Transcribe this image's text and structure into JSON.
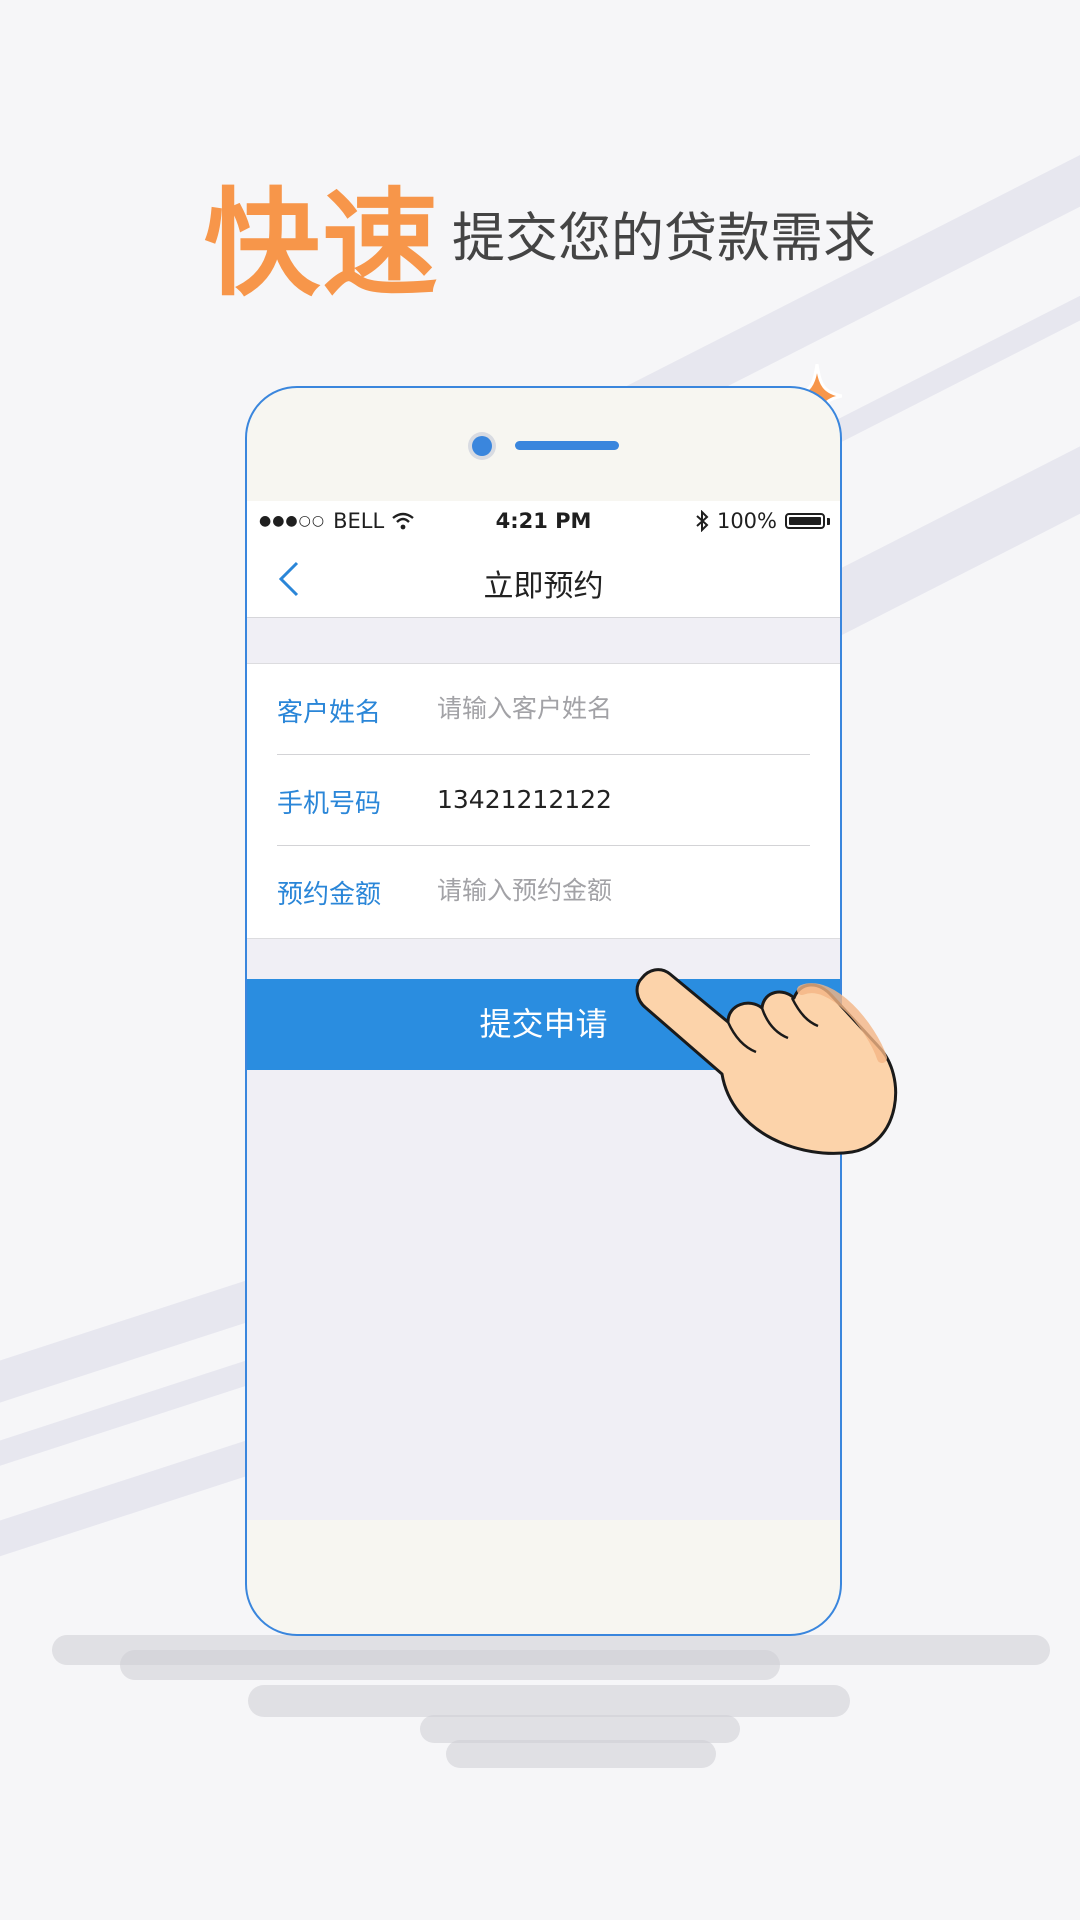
{
  "promo": {
    "headline_strong": "快速",
    "headline_rest": "提交您的贷款需求"
  },
  "status_bar": {
    "signal": "●●●○○",
    "carrier": "BELL",
    "time": "4:21 PM",
    "battery": "100%",
    "battery_level": 1.0
  },
  "nav": {
    "title": "立即预约"
  },
  "form": {
    "fields": [
      {
        "label": "客户姓名",
        "value": "",
        "placeholder": "请输入客户姓名"
      },
      {
        "label": "手机号码",
        "value": "13421212122",
        "placeholder": ""
      },
      {
        "label": "预约金额",
        "value": "",
        "placeholder": "请输入预约金额"
      }
    ]
  },
  "submit": {
    "label": "提交申请"
  },
  "colors": {
    "accent_orange": "#f7964a",
    "primary_blue": "#2a8de0",
    "phone_outline": "#3a86dd",
    "label_blue": "#2a86d8"
  }
}
